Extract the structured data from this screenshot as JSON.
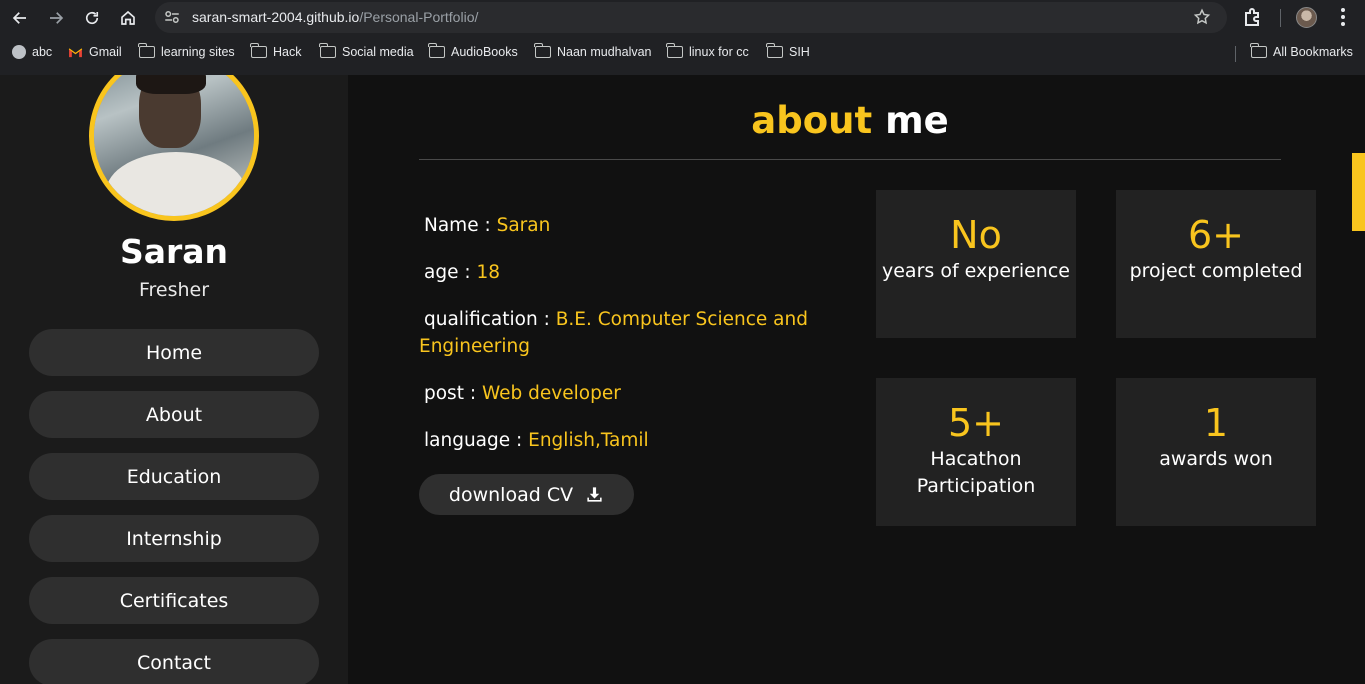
{
  "browser": {
    "url_host": "saran-smart-2004.github.io",
    "url_path": "/Personal-Portfolio/",
    "bookmarks": [
      {
        "label": "abc",
        "icon": "globe-icon"
      },
      {
        "label": "Gmail",
        "icon": "gmail-icon"
      },
      {
        "label": "learning sites",
        "icon": "folder-icon"
      },
      {
        "label": "Hack",
        "icon": "folder-icon"
      },
      {
        "label": "Social media",
        "icon": "folder-icon"
      },
      {
        "label": "AudioBooks",
        "icon": "folder-icon"
      },
      {
        "label": "Naan mudhalvan",
        "icon": "folder-icon"
      },
      {
        "label": "linux for cc",
        "icon": "folder-icon"
      },
      {
        "label": "SIH",
        "icon": "folder-icon"
      }
    ],
    "all_bookmarks": "All Bookmarks"
  },
  "sidebar": {
    "name": "Saran",
    "role": "Fresher",
    "nav": [
      "Home",
      "About",
      "Education",
      "Internship",
      "Certificates",
      "Contact"
    ]
  },
  "about": {
    "title_accent": "about",
    "title_rest": "me",
    "fields": [
      {
        "label": "Name :",
        "value": "Saran"
      },
      {
        "label": "age :",
        "value": "18"
      },
      {
        "label": "qualification :",
        "value": "B.E. Computer Science and Engineering"
      },
      {
        "label": "post :",
        "value": "Web developer"
      },
      {
        "label": "language :",
        "value": "English,Tamil"
      }
    ],
    "cv_button": "download CV",
    "stats": [
      {
        "num": "No",
        "label": "years of experience"
      },
      {
        "num": "6+",
        "label": "project completed"
      },
      {
        "num": "5+",
        "label": "Hacathon Participation"
      },
      {
        "num": "1",
        "label": "awards won"
      }
    ]
  },
  "colors": {
    "accent": "#f9c51e",
    "background": "#111111",
    "sidebar": "#1b1b1b",
    "card": "#222222"
  }
}
